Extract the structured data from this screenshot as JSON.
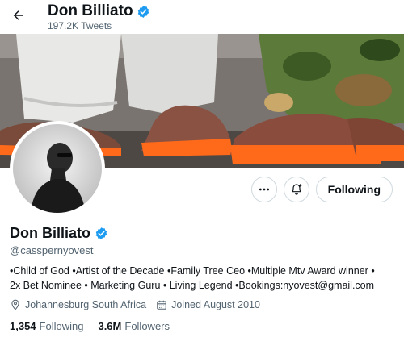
{
  "header": {
    "title": "Don Billiato",
    "subtitle": "197.2K Tweets",
    "back_icon": "arrow-left-icon"
  },
  "profile": {
    "name": "Don Billiato",
    "handle": "@casspernyovest",
    "verified": true,
    "bio_line1": "•Child of God •Artist of the Decade •Family Tree Ceo •Multiple Mtv Award winner •",
    "bio_line2": "2x Bet Nominee • Marketing Guru • Living Legend •Bookings:nyovest@gmail.com",
    "location": "Johannesburg South Africa",
    "joined": "Joined August 2010",
    "following_count": "1,354",
    "following_label": "Following",
    "followers_count": "3.6M",
    "followers_label": "Followers"
  },
  "actions": {
    "more_icon": "more-horizontal-icon",
    "notify_icon": "bell-plus-icon",
    "follow_button_label": "Following"
  },
  "colors": {
    "accent": "#1d9bf0",
    "text": "#0f1419",
    "muted": "#536471",
    "border": "#cfd9de"
  }
}
